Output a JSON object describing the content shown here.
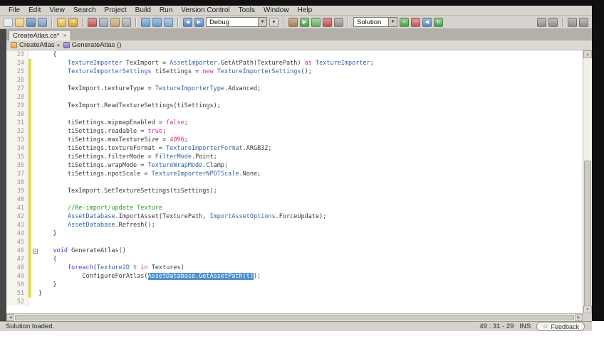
{
  "menubar": {
    "items": [
      "File",
      "Edit",
      "View",
      "Search",
      "Project",
      "Build",
      "Run",
      "Version Control",
      "Tools",
      "Window",
      "Help"
    ]
  },
  "toolbar": {
    "items": [
      {
        "kind": "icon",
        "name": "new-file-icon",
        "color": "#dfe7f2"
      },
      {
        "kind": "icon",
        "name": "open-file-icon",
        "color": "#edc96b"
      },
      {
        "kind": "icon",
        "name": "save-icon",
        "color": "#5b84bb"
      },
      {
        "kind": "icon",
        "name": "save-all-icon",
        "color": "#7d9cc6"
      },
      {
        "kind": "sep"
      },
      {
        "kind": "icon",
        "name": "undo-icon",
        "color": "#eab93d",
        "glyph": "↶"
      },
      {
        "kind": "icon",
        "name": "redo-icon",
        "color": "#d8a42e",
        "glyph": "↷"
      },
      {
        "kind": "sep"
      },
      {
        "kind": "icon",
        "name": "cut-icon",
        "color": "#c25555"
      },
      {
        "kind": "icon",
        "name": "copy-icon",
        "color": "#93a3b6"
      },
      {
        "kind": "icon",
        "name": "paste-icon",
        "color": "#c3a566"
      },
      {
        "kind": "icon",
        "name": "delete-icon",
        "color": "#a8a8a8"
      },
      {
        "kind": "sep"
      },
      {
        "kind": "icon",
        "name": "search-icon",
        "color": "#5f9bd3"
      },
      {
        "kind": "icon",
        "name": "find-replace-icon",
        "color": "#5f9bd3"
      },
      {
        "kind": "icon",
        "name": "find-in-files-icon",
        "color": "#76a9da"
      },
      {
        "kind": "sep"
      },
      {
        "kind": "icon",
        "name": "navigate-back-icon",
        "color": "#4f88c9",
        "glyph": "◀"
      },
      {
        "kind": "icon",
        "name": "navigate-forward-icon",
        "color": "#4f88c9",
        "glyph": "▶"
      },
      {
        "kind": "combo",
        "name": "run-configuration-combo",
        "value": "Debug",
        "width": 86
      },
      {
        "kind": "icon",
        "name": "device-target-dropdown-icon",
        "color": "#d6d3ce",
        "glyph": "▼",
        "fg": "#444"
      },
      {
        "kind": "sep"
      },
      {
        "kind": "icon",
        "name": "build-icon",
        "color": "#a87e4d"
      },
      {
        "kind": "icon",
        "name": "run-icon",
        "color": "#4aa34a",
        "glyph": "▶"
      },
      {
        "kind": "icon",
        "name": "debug-run-icon",
        "color": "#61b061"
      },
      {
        "kind": "icon",
        "name": "stop-icon",
        "color": "#c24a4a"
      },
      {
        "kind": "icon",
        "name": "attach-debugger-icon",
        "color": "#8f8f8f"
      },
      {
        "kind": "sep"
      },
      {
        "kind": "combo",
        "name": "solution-scope-combo",
        "value": "Solution",
        "width": 62
      },
      {
        "kind": "icon",
        "name": "add-icon",
        "color": "#4aa34a",
        "glyph": "+"
      },
      {
        "kind": "icon",
        "name": "remove-icon",
        "color": "#c25555",
        "glyph": "−"
      },
      {
        "kind": "icon",
        "name": "previous-result-icon",
        "color": "#4f88c9",
        "glyph": "◀"
      },
      {
        "kind": "icon",
        "name": "refresh-icon",
        "color": "#4aa34a",
        "glyph": "↻"
      },
      {
        "kind": "spacer"
      },
      {
        "kind": "icon",
        "name": "toggle-fold-icon",
        "color": "#8d8d8d"
      },
      {
        "kind": "icon",
        "name": "toggle-outline-icon",
        "color": "#8d8d8d"
      },
      {
        "kind": "sep"
      },
      {
        "kind": "icon",
        "name": "pads-layout-icon",
        "color": "#8d8d8d"
      },
      {
        "kind": "icon",
        "name": "fullscreen-icon",
        "color": "#8d8d8d"
      }
    ]
  },
  "tabs": [
    {
      "label": "CreateAtlas.cs*",
      "close_glyph": "×"
    }
  ],
  "breadcrumb": {
    "items": [
      {
        "label": "CreateAtlas"
      },
      {
        "label": "GenerateAtlas ()"
      }
    ],
    "separator": "▸"
  },
  "editor": {
    "lines": [
      {
        "no": 23,
        "changed": false,
        "tokens": [
          [
            "p",
            "    {"
          ]
        ]
      },
      {
        "no": 24,
        "changed": true,
        "tokens": [
          [
            "p",
            "        "
          ],
          [
            "ty",
            "TextureImporter"
          ],
          [
            "p",
            " TexImport = "
          ],
          [
            "ty",
            "AssetImporter"
          ],
          [
            "p",
            ".GetAtPath(TexturePath) "
          ],
          [
            "k",
            "as"
          ],
          [
            "p",
            " "
          ],
          [
            "ty",
            "TextureImporter"
          ],
          [
            "p",
            ";"
          ]
        ]
      },
      {
        "no": 25,
        "changed": true,
        "tokens": [
          [
            "p",
            "        "
          ],
          [
            "ty",
            "TextureImporterSettings"
          ],
          [
            "p",
            " tiSettings = "
          ],
          [
            "k",
            "new"
          ],
          [
            "p",
            " "
          ],
          [
            "ty",
            "TextureImporterSettings"
          ],
          [
            "p",
            "();"
          ]
        ]
      },
      {
        "no": 26,
        "changed": true,
        "tokens": []
      },
      {
        "no": 27,
        "changed": true,
        "tokens": [
          [
            "p",
            "        TexImport.textureType = "
          ],
          [
            "ty",
            "TextureImporterType"
          ],
          [
            "p",
            ".Advanced;"
          ]
        ]
      },
      {
        "no": 28,
        "changed": true,
        "tokens": []
      },
      {
        "no": 29,
        "changed": true,
        "tokens": [
          [
            "p",
            "        TexImport.ReadTextureSettings(tiSettings);"
          ]
        ]
      },
      {
        "no": 30,
        "changed": true,
        "tokens": []
      },
      {
        "no": 31,
        "changed": true,
        "tokens": [
          [
            "p",
            "        tiSettings.mipmapEnabled = "
          ],
          [
            "k",
            "false"
          ],
          [
            "p",
            ";"
          ]
        ]
      },
      {
        "no": 32,
        "changed": true,
        "tokens": [
          [
            "p",
            "        tiSettings.readable = "
          ],
          [
            "k",
            "true"
          ],
          [
            "p",
            ";"
          ]
        ]
      },
      {
        "no": 33,
        "changed": true,
        "tokens": [
          [
            "p",
            "        tiSettings.maxTextureSize = "
          ],
          [
            "n",
            "4096"
          ],
          [
            "p",
            ";"
          ]
        ]
      },
      {
        "no": 34,
        "changed": true,
        "tokens": [
          [
            "p",
            "        tiSettings.textureFormat = "
          ],
          [
            "ty",
            "TextureImporterFormat"
          ],
          [
            "p",
            ".ARGB32;"
          ]
        ]
      },
      {
        "no": 35,
        "changed": true,
        "tokens": [
          [
            "p",
            "        tiSettings.filterMode = "
          ],
          [
            "ty",
            "FilterMode"
          ],
          [
            "p",
            ".Point;"
          ]
        ]
      },
      {
        "no": 36,
        "changed": true,
        "tokens": [
          [
            "p",
            "        tiSettings.wrapMode = "
          ],
          [
            "ty",
            "TextureWrapMode"
          ],
          [
            "p",
            ".Clamp;"
          ]
        ]
      },
      {
        "no": 37,
        "changed": true,
        "tokens": [
          [
            "p",
            "        tiSettings.npotScale = "
          ],
          [
            "ty",
            "TextureImporterNPOTScale"
          ],
          [
            "p",
            ".None;"
          ]
        ]
      },
      {
        "no": 38,
        "changed": true,
        "tokens": []
      },
      {
        "no": 39,
        "changed": true,
        "tokens": [
          [
            "p",
            "        TexImport.SetTextureSettings(tiSettings);"
          ]
        ]
      },
      {
        "no": 40,
        "changed": true,
        "tokens": []
      },
      {
        "no": 41,
        "changed": true,
        "tokens": [
          [
            "p",
            "        "
          ],
          [
            "c",
            "//Re-import/update Texture"
          ]
        ]
      },
      {
        "no": 42,
        "changed": true,
        "tokens": [
          [
            "p",
            "        "
          ],
          [
            "ty",
            "AssetDatabase"
          ],
          [
            "p",
            ".ImportAsset(TexturePath, "
          ],
          [
            "ty",
            "ImportAssetOptions"
          ],
          [
            "p",
            ".ForceUpdate);"
          ]
        ]
      },
      {
        "no": 43,
        "changed": true,
        "tokens": [
          [
            "p",
            "        "
          ],
          [
            "ty",
            "AssetDatabase"
          ],
          [
            "p",
            ".Refresh();"
          ]
        ]
      },
      {
        "no": 44,
        "changed": true,
        "tokens": [
          [
            "p",
            "    }"
          ]
        ]
      },
      {
        "no": 45,
        "changed": true,
        "tokens": []
      },
      {
        "no": 46,
        "changed": true,
        "fold": true,
        "tokens": [
          [
            "p",
            "    "
          ],
          [
            "kb",
            "void"
          ],
          [
            "p",
            " GenerateAtlas()"
          ]
        ]
      },
      {
        "no": 47,
        "changed": true,
        "tokens": [
          [
            "p",
            "    {"
          ]
        ]
      },
      {
        "no": 48,
        "changed": true,
        "tokens": [
          [
            "p",
            "        "
          ],
          [
            "kb",
            "foreach"
          ],
          [
            "p",
            "("
          ],
          [
            "ty",
            "Texture2D"
          ],
          [
            "p",
            " t "
          ],
          [
            "k",
            "in"
          ],
          [
            "p",
            " Textures)"
          ]
        ]
      },
      {
        "no": 49,
        "changed": true,
        "tokens": [
          [
            "p",
            "            ConfigureForAtlas("
          ],
          [
            "sel",
            "AssetDatabase.GetAssetPath(t)"
          ],
          [
            "p",
            ");"
          ]
        ]
      },
      {
        "no": 50,
        "changed": true,
        "tokens": [
          [
            "p",
            "    }"
          ]
        ]
      },
      {
        "no": 51,
        "changed": true,
        "tokens": [
          [
            "p",
            "}"
          ]
        ]
      },
      {
        "no": 52,
        "changed": false,
        "tokens": []
      }
    ]
  },
  "statusbar": {
    "left_text": "Solution loaded.",
    "caret_position": "49 : 31 - 29",
    "input_mode": "INS",
    "feedback_label": "Feedback",
    "feedback_smiley": "☺"
  },
  "colors": {
    "selection": "#4c8fce",
    "changed_line_marker": "#e3df45",
    "type": "#3364a4",
    "keyword_pink": "#cf2f9f",
    "keyword_blue": "#3b48c8",
    "comment": "#2e9b2e"
  }
}
